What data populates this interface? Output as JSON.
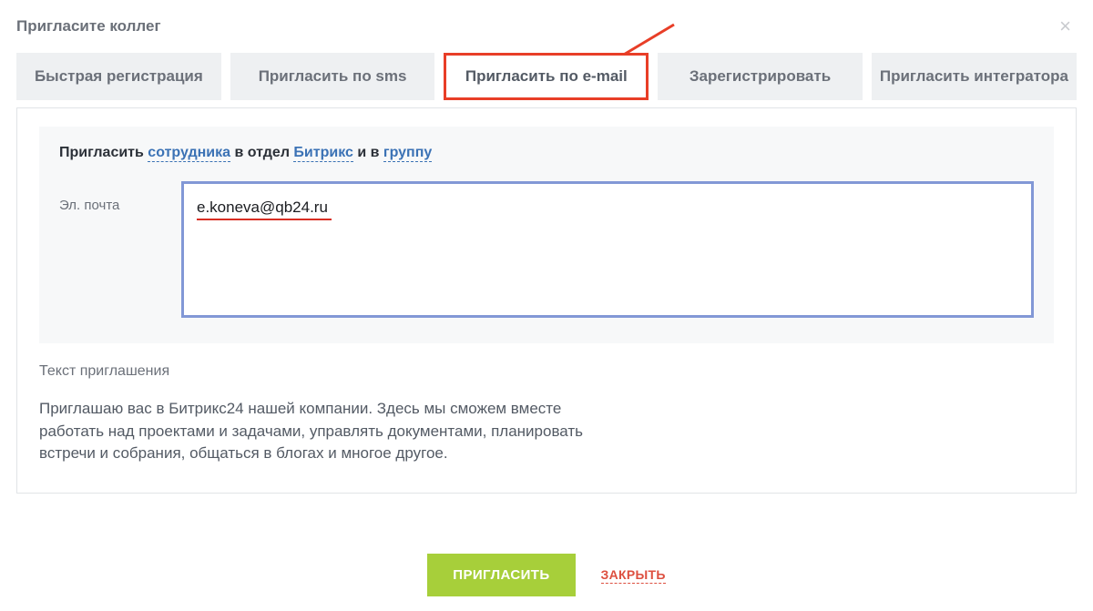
{
  "header": {
    "title": "Пригласите коллег"
  },
  "tabs": [
    {
      "label": "Быстрая регистрация"
    },
    {
      "label": "Пригласить по sms"
    },
    {
      "label": "Пригласить по e-mail"
    },
    {
      "label": "Зарегистрировать"
    },
    {
      "label": "Пригласить интегратора"
    }
  ],
  "invite_sentence": {
    "t1": "Пригласить ",
    "link1": "сотрудника",
    "t2": " в отдел ",
    "link2": "Битрикс",
    "t3": " и в ",
    "link3": "группу"
  },
  "field": {
    "label": "Эл. почта",
    "value": "e.koneva@qb24.ru"
  },
  "invitation_text": {
    "label": "Текст приглашения",
    "body": "Приглашаю вас в Битрикс24 нашей компании. Здесь мы сможем вместе работать над проектами и задачами, управлять документами, планировать встречи и собрания, общаться в блогах и многое другое."
  },
  "footer": {
    "primary": "ПРИГЛАСИТЬ",
    "secondary": "ЗАКРЫТЬ"
  }
}
